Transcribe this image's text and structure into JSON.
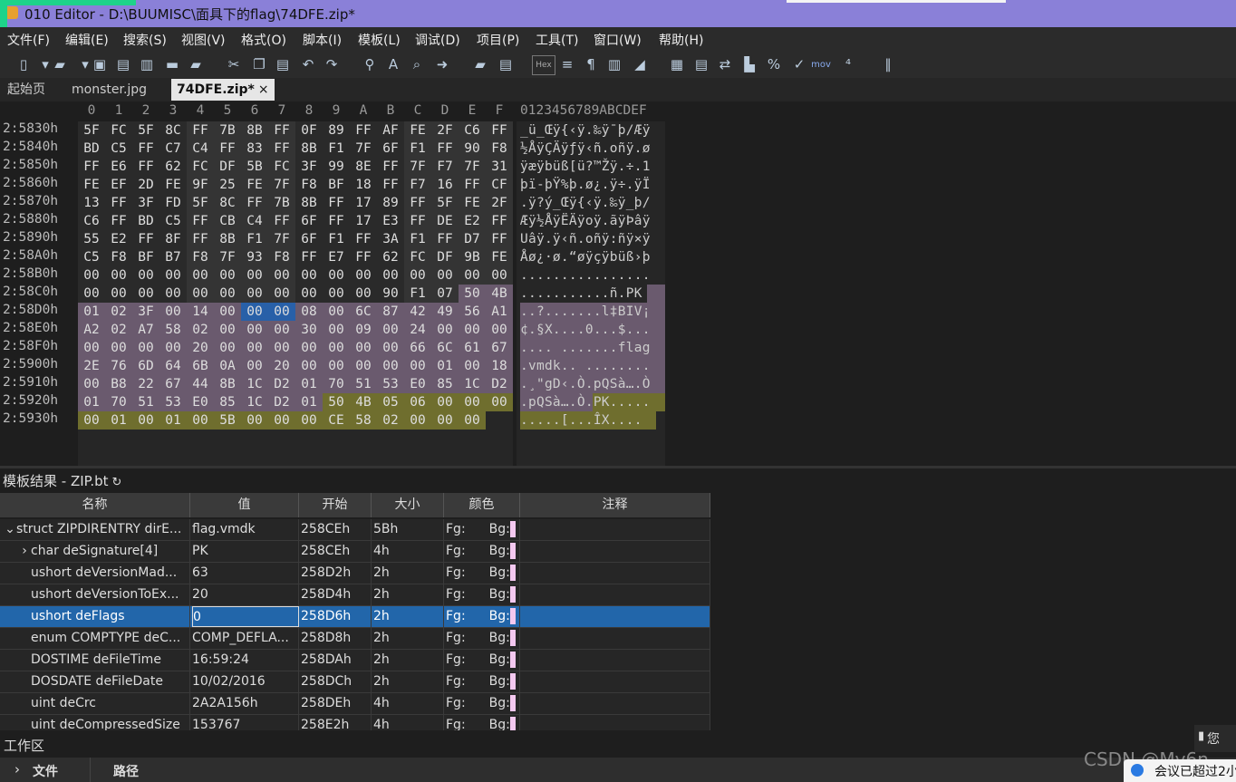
{
  "window": {
    "title": "010 Editor - D:\\BUUMISC\\面具下的flag\\74DFE.zip*"
  },
  "menu": [
    "文件(F)",
    "编辑(E)",
    "搜索(S)",
    "视图(V)",
    "格式(O)",
    "脚本(I)",
    "模板(L)",
    "调试(D)",
    "项目(P)",
    "工具(T)",
    "窗口(W)",
    "帮助(H)"
  ],
  "toolbar": {
    "icons": [
      "new-file-icon",
      "dropdown-icon",
      "open-folder-icon",
      "dropdown-icon",
      "save-icon",
      "save-as-icon",
      "save-all-icon",
      "open-folder-2-icon",
      "folders-icon",
      "cut-icon",
      "copy-icon",
      "paste-icon",
      "undo-icon",
      "redo-icon",
      "find-icon",
      "replace-icon",
      "find-in-files-icon",
      "goto-icon",
      "compare-icon",
      "script-icon",
      "hex-toggle-icon",
      "text-format-icon",
      "paragraph-icon",
      "columns-icon",
      "highlight-icon",
      "calculator-icon",
      "template-icon",
      "swap-icon",
      "histogram-icon",
      "percent-icon",
      "checksum-icon",
      "mov-icon",
      "base-convert-icon",
      "pause-icon"
    ],
    "hex_label": "Hex",
    "mov_label": "mov"
  },
  "tabs": [
    {
      "label": "起始页",
      "active": false
    },
    {
      "label": "monster.jpg",
      "active": false
    },
    {
      "label": "74DFE.zip*",
      "active": true,
      "close": "×"
    }
  ],
  "hex": {
    "column_headers": [
      "0",
      "1",
      "2",
      "3",
      "4",
      "5",
      "6",
      "7",
      "8",
      "9",
      "A",
      "B",
      "C",
      "D",
      "E",
      "F"
    ],
    "ascii_header": "0123456789ABCDEF",
    "rows": [
      {
        "addr": "2:5830h",
        "bytes": [
          "5F",
          "FC",
          "5F",
          "8C",
          "FF",
          "7B",
          "8B",
          "FF",
          "0F",
          "89",
          "FF",
          "AF",
          "FE",
          "2F",
          "C6",
          "FF"
        ],
        "ascii": "_ü_Œÿ{‹ÿ.‰ÿ¯þ/Æÿ"
      },
      {
        "addr": "2:5840h",
        "bytes": [
          "BD",
          "C5",
          "FF",
          "C7",
          "C4",
          "FF",
          "83",
          "FF",
          "8B",
          "F1",
          "7F",
          "6F",
          "F1",
          "FF",
          "90",
          "F8"
        ],
        "ascii": "½ÅÿÇÄÿƒÿ‹ñ.oñÿ.ø"
      },
      {
        "addr": "2:5850h",
        "bytes": [
          "FF",
          "E6",
          "FF",
          "62",
          "FC",
          "DF",
          "5B",
          "FC",
          "3F",
          "99",
          "8E",
          "FF",
          "7F",
          "F7",
          "7F",
          "31"
        ],
        "ascii": "ÿæÿbüß[ü?™Žÿ.÷.1"
      },
      {
        "addr": "2:5860h",
        "bytes": [
          "FE",
          "EF",
          "2D",
          "FE",
          "9F",
          "25",
          "FE",
          "7F",
          "F8",
          "BF",
          "18",
          "FF",
          "F7",
          "16",
          "FF",
          "CF"
        ],
        "ascii": "þï-þŸ%þ.ø¿.ÿ÷.ÿÏ"
      },
      {
        "addr": "2:5870h",
        "bytes": [
          "13",
          "FF",
          "3F",
          "FD",
          "5F",
          "8C",
          "FF",
          "7B",
          "8B",
          "FF",
          "17",
          "89",
          "FF",
          "5F",
          "FE",
          "2F"
        ],
        "ascii": ".ÿ?ý_Œÿ{‹ÿ.‰ÿ_þ/"
      },
      {
        "addr": "2:5880h",
        "bytes": [
          "C6",
          "FF",
          "BD",
          "C5",
          "FF",
          "CB",
          "C4",
          "FF",
          "6F",
          "FF",
          "17",
          "E3",
          "FF",
          "DE",
          "E2",
          "FF"
        ],
        "ascii": "Æÿ½ÅÿËÄÿoÿ.ãÿÞâÿ"
      },
      {
        "addr": "2:5890h",
        "bytes": [
          "55",
          "E2",
          "FF",
          "8F",
          "FF",
          "8B",
          "F1",
          "7F",
          "6F",
          "F1",
          "FF",
          "3A",
          "F1",
          "FF",
          "D7",
          "FF"
        ],
        "ascii": "Uâÿ.ÿ‹ñ.oñÿ:ñÿ×ÿ"
      },
      {
        "addr": "2:58A0h",
        "bytes": [
          "C5",
          "F8",
          "BF",
          "B7",
          "F8",
          "7F",
          "93",
          "F8",
          "FF",
          "E7",
          "FF",
          "62",
          "FC",
          "DF",
          "9B",
          "FE"
        ],
        "ascii": "Åø¿·ø.“øÿçÿbüß›þ"
      },
      {
        "addr": "2:58B0h",
        "bytes": [
          "00",
          "00",
          "00",
          "00",
          "00",
          "00",
          "00",
          "00",
          "00",
          "00",
          "00",
          "00",
          "00",
          "00",
          "00",
          "00"
        ],
        "ascii": "................"
      },
      {
        "addr": "2:58C0h",
        "bytes": [
          "00",
          "00",
          "00",
          "00",
          "00",
          "00",
          "00",
          "00",
          "00",
          "00",
          "00",
          "90",
          "F1",
          "07",
          "50",
          "4B"
        ],
        "ascii": "...........ñ.PK"
      },
      {
        "addr": "2:58D0h",
        "bytes": [
          "01",
          "02",
          "3F",
          "00",
          "14",
          "00",
          "00",
          "00",
          "08",
          "00",
          "6C",
          "87",
          "42",
          "49",
          "56",
          "A1"
        ],
        "ascii": "..?.......l‡BIV¡"
      },
      {
        "addr": "2:58E0h",
        "bytes": [
          "A2",
          "02",
          "A7",
          "58",
          "02",
          "00",
          "00",
          "00",
          "30",
          "00",
          "09",
          "00",
          "24",
          "00",
          "00",
          "00"
        ],
        "ascii": "¢.§X....0...$..."
      },
      {
        "addr": "2:58F0h",
        "bytes": [
          "00",
          "00",
          "00",
          "00",
          "20",
          "00",
          "00",
          "00",
          "00",
          "00",
          "00",
          "00",
          "66",
          "6C",
          "61",
          "67"
        ],
        "ascii": ".... .......flag"
      },
      {
        "addr": "2:5900h",
        "bytes": [
          "2E",
          "76",
          "6D",
          "64",
          "6B",
          "0A",
          "00",
          "20",
          "00",
          "00",
          "00",
          "00",
          "00",
          "01",
          "00",
          "18"
        ],
        "ascii": ".vmdk.. ........"
      },
      {
        "addr": "2:5910h",
        "bytes": [
          "00",
          "B8",
          "22",
          "67",
          "44",
          "8B",
          "1C",
          "D2",
          "01",
          "70",
          "51",
          "53",
          "E0",
          "85",
          "1C",
          "D2"
        ],
        "ascii": ".¸\"gD‹.Ò.pQSà….Ò"
      },
      {
        "addr": "2:5920h",
        "bytes": [
          "01",
          "70",
          "51",
          "53",
          "E0",
          "85",
          "1C",
          "D2",
          "01",
          "50",
          "4B",
          "05",
          "06",
          "00",
          "00",
          "00"
        ],
        "ascii": ".pQSà….Ò.PK....."
      },
      {
        "addr": "2:5930h",
        "bytes": [
          "00",
          "01",
          "00",
          "01",
          "00",
          "5B",
          "00",
          "00",
          "00",
          "CE",
          "58",
          "02",
          "00",
          "00",
          "00"
        ],
        "ascii": ".....[...ÎX...."
      }
    ]
  },
  "template": {
    "title": "模板结果 - ZIP.bt",
    "refresh_glyph": "↻",
    "columns": [
      "名称",
      "值",
      "开始",
      "大小",
      "颜色",
      "注释"
    ],
    "rows": [
      {
        "expander": "⌄",
        "name": "struct ZIPDIRENTRY dirE...",
        "value": "flag.vmdk",
        "start": "258CEh",
        "size": "5Bh",
        "fg": "Fg:",
        "bg": "Bg:",
        "selected": false,
        "indent": 0
      },
      {
        "expander": "›",
        "name": "char deSignature[4]",
        "value": "PK\u0001",
        "start": "258CEh",
        "size": "4h",
        "fg": "Fg:",
        "bg": "Bg:",
        "selected": false,
        "indent": 1
      },
      {
        "expander": "",
        "name": "ushort deVersionMad...",
        "value": "63",
        "start": "258D2h",
        "size": "2h",
        "fg": "Fg:",
        "bg": "Bg:",
        "selected": false,
        "indent": 1
      },
      {
        "expander": "",
        "name": "ushort deVersionToEx...",
        "value": "20",
        "start": "258D4h",
        "size": "2h",
        "fg": "Fg:",
        "bg": "Bg:",
        "selected": false,
        "indent": 1
      },
      {
        "expander": "",
        "name": "ushort deFlags",
        "value": "0",
        "start": "258D6h",
        "size": "2h",
        "fg": "Fg:",
        "bg": "Bg:",
        "selected": true,
        "indent": 1
      },
      {
        "expander": "",
        "name": "enum COMPTYPE deC...",
        "value": "COMP_DEFLA...",
        "start": "258D8h",
        "size": "2h",
        "fg": "Fg:",
        "bg": "Bg:",
        "selected": false,
        "indent": 1
      },
      {
        "expander": "",
        "name": "DOSTIME deFileTime",
        "value": "16:59:24",
        "start": "258DAh",
        "size": "2h",
        "fg": "Fg:",
        "bg": "Bg:",
        "selected": false,
        "indent": 1
      },
      {
        "expander": "",
        "name": "DOSDATE deFileDate",
        "value": "10/02/2016",
        "start": "258DCh",
        "size": "2h",
        "fg": "Fg:",
        "bg": "Bg:",
        "selected": false,
        "indent": 1
      },
      {
        "expander": "",
        "name": "uint deCrc",
        "value": "2A2A156h",
        "start": "258DEh",
        "size": "4h",
        "fg": "Fg:",
        "bg": "Bg:",
        "selected": false,
        "indent": 1
      },
      {
        "expander": "",
        "name": "uint deCompressedSize",
        "value": "153767",
        "start": "258E2h",
        "size": "4h",
        "fg": "Fg:",
        "bg": "Bg:",
        "selected": false,
        "indent": 1
      }
    ]
  },
  "workspace": {
    "title": "工作区",
    "chevron": "›",
    "col_file": "文件",
    "col_path": "路径"
  },
  "overlay": {
    "watermark": "CSDN @My6n",
    "notification": "会议已超过2小",
    "signal_label": "您"
  },
  "colors": {
    "titlebar": "#8a80d8",
    "pk_highlight": "#6a5a6e",
    "olive_highlight": "#6f6e2e",
    "selection": "#2266aa"
  }
}
